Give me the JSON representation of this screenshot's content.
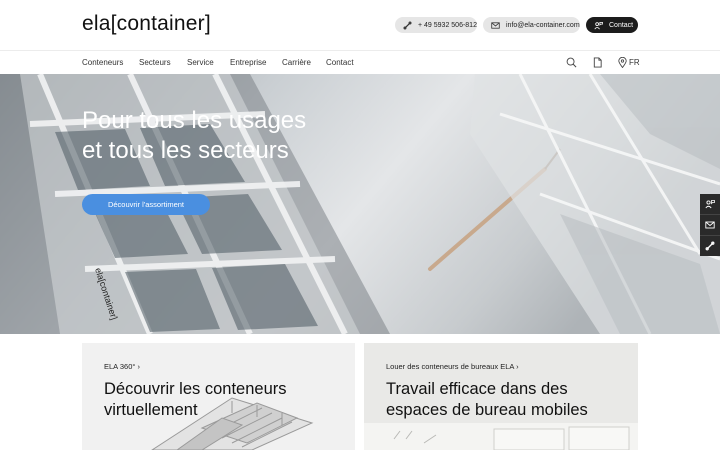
{
  "header": {
    "logo": "ela[container]",
    "phone": "+ 49 5932 506-812",
    "email": "info@ela-container.com",
    "contact": "Contact"
  },
  "nav": {
    "items": [
      {
        "label": "Conteneurs"
      },
      {
        "label": "Secteurs"
      },
      {
        "label": "Service"
      },
      {
        "label": "Entreprise"
      },
      {
        "label": "Carrière"
      },
      {
        "label": "Contact"
      }
    ],
    "language": "FR",
    "icons": [
      "search-icon",
      "document-icon",
      "location-pin-icon"
    ]
  },
  "hero": {
    "title_line1": "Pour tous les usages",
    "title_line2": "et tous les secteurs",
    "cta": "Découvrir l'assortiment",
    "sign_text": "ela[container]"
  },
  "side_tab": {
    "icons": [
      "contact-person-icon",
      "mail-icon",
      "phone-icon"
    ]
  },
  "cards": [
    {
      "kicker": "ELA 360° ›",
      "title_line1": "Découvrir les conteneurs",
      "title_line2": "virtuellement"
    },
    {
      "kicker": "Louer des conteneurs de bureaux ELA ›",
      "title_line1": "Travail efficace dans des",
      "title_line2": "espaces de bureau mobiles"
    }
  ],
  "colors": {
    "accent_button": "#4a8fe0",
    "dark_pill": "#1c1c1c",
    "light_pill": "#e6e6e6"
  }
}
